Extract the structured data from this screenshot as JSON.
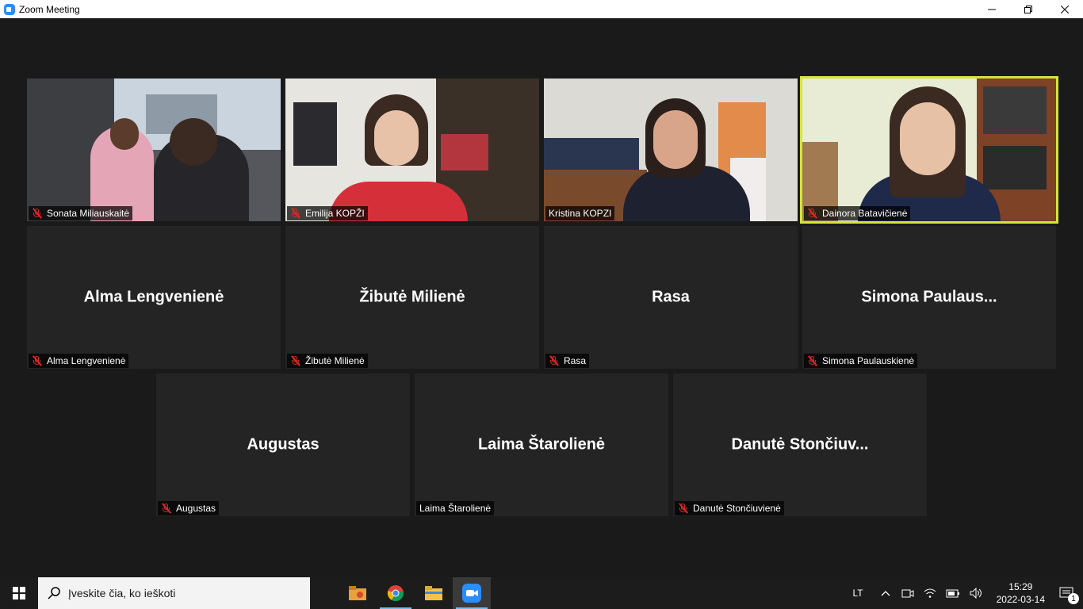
{
  "window": {
    "title": "Zoom Meeting"
  },
  "accent": "#d6e33a",
  "mute_color": "#e02828",
  "tiles": [
    {
      "label": "Sonata Miliauskaitė",
      "muted": true
    },
    {
      "label": "Emilija KOPŽI",
      "muted": true
    },
    {
      "label": "Kristina KOPZI",
      "muted": false
    },
    {
      "label": "Dainora Batavičienė",
      "muted": true
    },
    {
      "big": "Alma Lengvenienė",
      "label": "Alma Lengvenienė",
      "muted": true
    },
    {
      "big": "Žibutė Milienė",
      "label": "Žibutė Milienė",
      "muted": true
    },
    {
      "big": "Rasa",
      "label": "Rasa",
      "muted": true
    },
    {
      "big": "Simona  Paulaus...",
      "label": "Simona Paulauskienė",
      "muted": true
    },
    {
      "big": "Augustas",
      "label": "Augustas",
      "muted": true
    },
    {
      "big": "Laima Štarolienė",
      "label": "Laima Štarolienė",
      "muted": false
    },
    {
      "big": "Danutė  Stončiuv...",
      "label": "Danutė Stončiuvienė",
      "muted": true
    }
  ],
  "taskbar": {
    "search_placeholder": "Įveskite čia, ko ieškoti",
    "language": "LT",
    "time": "15:29",
    "date": "2022-03-14",
    "notification_count": "1",
    "apps": [
      "file-explorer-shortcut-icon",
      "chrome-icon",
      "file-explorer-icon",
      "zoom-icon"
    ]
  }
}
